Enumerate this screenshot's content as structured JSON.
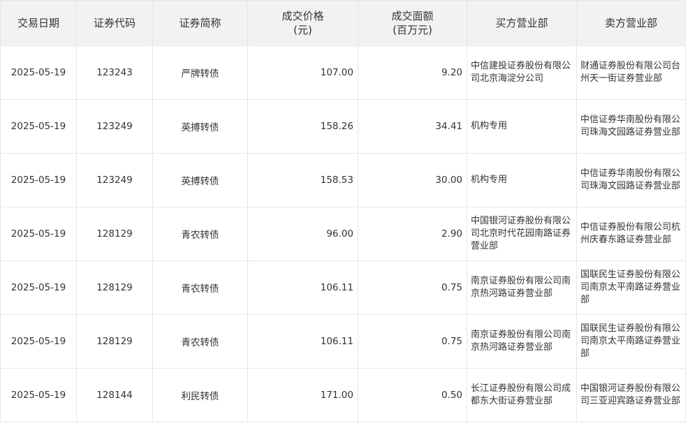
{
  "table": {
    "headers": {
      "date": "交易日期",
      "code": "证券代码",
      "name": "证券简称",
      "price_line1": "成交价格",
      "price_line2": "(元)",
      "amount_line1": "成交面额",
      "amount_line2": "(百万元)",
      "buyer": "买方营业部",
      "seller": "卖方营业部"
    },
    "rows": [
      {
        "date": "2025-05-19",
        "code": "123243",
        "name": "严牌转债",
        "price": "107.00",
        "amount": "9.20",
        "buyer": "中信建投证券股份有限公司北京海淀分公司",
        "seller": "财通证券股份有限公司台州天一街证券营业部"
      },
      {
        "date": "2025-05-19",
        "code": "123249",
        "name": "英搏转债",
        "price": "158.26",
        "amount": "34.41",
        "buyer": "机构专用",
        "seller": "中信证券华南股份有限公司珠海文园路证券营业部"
      },
      {
        "date": "2025-05-19",
        "code": "123249",
        "name": "英搏转债",
        "price": "158.53",
        "amount": "30.00",
        "buyer": "机构专用",
        "seller": "中信证券华南股份有限公司珠海文园路证券营业部"
      },
      {
        "date": "2025-05-19",
        "code": "128129",
        "name": "青农转债",
        "price": "96.00",
        "amount": "2.90",
        "buyer": "中国银河证券股份有限公司北京时代花园南路证券营业部",
        "seller": "中信证券股份有限公司杭州庆春东路证券营业部"
      },
      {
        "date": "2025-05-19",
        "code": "128129",
        "name": "青农转债",
        "price": "106.11",
        "amount": "0.75",
        "buyer": "南京证券股份有限公司南京热河路证券营业部",
        "seller": "国联民生证券股份有限公司南京太平南路证券营业部"
      },
      {
        "date": "2025-05-19",
        "code": "128129",
        "name": "青农转债",
        "price": "106.11",
        "amount": "0.75",
        "buyer": "南京证券股份有限公司南京热河路证券营业部",
        "seller": "国联民生证券股份有限公司南京太平南路证券营业部"
      },
      {
        "date": "2025-05-19",
        "code": "128144",
        "name": "利民转债",
        "price": "171.00",
        "amount": "0.50",
        "buyer": "长江证券股份有限公司成都东大街证券营业部",
        "seller": "中国银河证券股份有限公司三亚迎宾路证券营业部"
      }
    ]
  }
}
